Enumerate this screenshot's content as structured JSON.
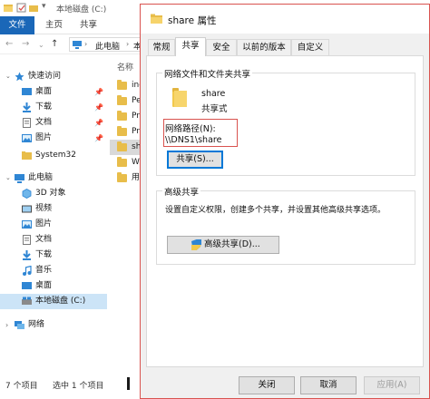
{
  "explorer": {
    "title": "本地磁盘 (C:)",
    "ribbon": {
      "file": "文件",
      "tabs": [
        "主页",
        "共享"
      ]
    },
    "address": {
      "items": [
        "此电脑",
        "本"
      ]
    },
    "nav": {
      "quick_access": "快速访问",
      "pinned": [
        "桌面",
        "下载",
        "文档",
        "图片"
      ],
      "system32": "System32",
      "this_pc": "此电脑",
      "pc_items": [
        "3D 对象",
        "视频",
        "图片",
        "文档",
        "下载",
        "音乐",
        "桌面"
      ],
      "local_disk": "本地磁盘 (C:)",
      "network": "网络"
    },
    "files": {
      "column_name": "名称",
      "items": [
        "ine",
        "Pe",
        "Pro",
        "Pro",
        "sha",
        "Wi",
        "用"
      ]
    },
    "status": {
      "count": "7 个项目",
      "selected": "选中 1 个项目"
    }
  },
  "dialog": {
    "title": "share 属性",
    "tabs": [
      "常规",
      "共享",
      "安全",
      "以前的版本",
      "自定义"
    ],
    "network_group": {
      "title": "网络文件和文件夹共享",
      "folder_name": "share",
      "share_state": "共享式",
      "path_label": "网络路径(N):",
      "path_value": "\\\\DNS1\\share",
      "share_button": "共享(S)..."
    },
    "advanced_group": {
      "title": "高级共享",
      "description": "设置自定义权限，创建多个共享，并设置其他高级共享选项。",
      "button": "高级共享(D)..."
    },
    "footer": {
      "close": "关闭",
      "cancel": "取消",
      "apply": "应用(A)"
    }
  },
  "colors": {
    "accent": "#1a67b8",
    "highlight_box": "#d9534f",
    "folder": "#f2c94c"
  }
}
